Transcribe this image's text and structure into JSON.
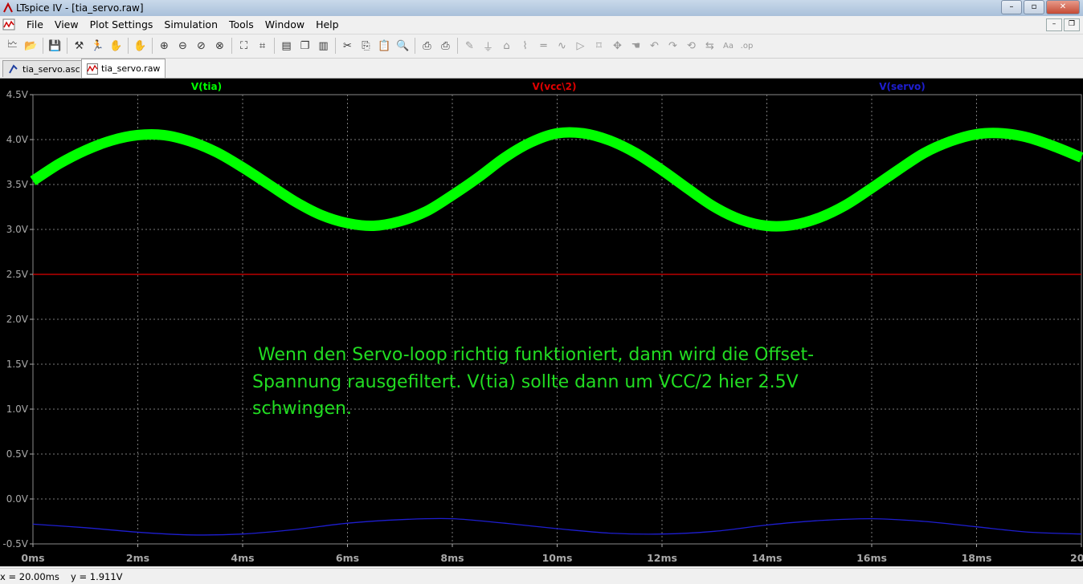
{
  "window": {
    "title": "LTspice IV - [tia_servo.raw]"
  },
  "window_buttons": [
    "–",
    "▫",
    "✕"
  ],
  "menu": [
    "File",
    "View",
    "Plot Settings",
    "Simulation",
    "Tools",
    "Window",
    "Help"
  ],
  "mdi_buttons": [
    "–",
    "❐"
  ],
  "toolbar": {
    "icons": [
      "new-schematic-icon",
      "open-icon",
      "save-icon",
      "control-panel-icon",
      "run-icon",
      "halt-icon",
      "pan-icon",
      "zoom-in-icon",
      "zoom-out-icon",
      "zoom-fit-icon",
      "zoom-cancel-icon",
      "autorange-icon",
      "mark-icon",
      "tile-vertical-icon",
      "cascade-icon",
      "tile-horizontal-icon",
      "cut-icon",
      "copy-icon",
      "paste-icon",
      "find-icon",
      "print-preview-icon",
      "print-icon",
      "wire-icon",
      "ground-icon",
      "label-icon",
      "resistor-icon",
      "capacitor-icon",
      "inductor-icon",
      "diode-icon",
      "component-icon",
      "move-icon",
      "drag-icon",
      "undo-icon",
      "redo-icon",
      "rotate-icon",
      "mirror-icon",
      "text-icon",
      "spice-directive-icon"
    ]
  },
  "tabs": [
    {
      "label": "tia_servo.asc",
      "icon": "schematic-icon"
    },
    {
      "label": "tia_servo.raw",
      "icon": "waveform-icon",
      "active": true
    }
  ],
  "chart_data": {
    "type": "line",
    "background": "#000000",
    "grid": true,
    "xlim": [
      0,
      20
    ],
    "ylim": [
      -0.5,
      4.5
    ],
    "x_ticks": [
      "0ms",
      "2ms",
      "4ms",
      "6ms",
      "8ms",
      "10ms",
      "12ms",
      "14ms",
      "16ms",
      "18ms",
      "20ms"
    ],
    "y_ticks": [
      "4.5V",
      "4.0V",
      "3.5V",
      "3.0V",
      "2.5V",
      "2.0V",
      "1.5V",
      "1.0V",
      "0.5V",
      "0.0V",
      "-0.5V"
    ],
    "series": [
      {
        "name": "V(tia)",
        "color": "#00ff00",
        "x": [
          0,
          0.5,
          1,
          1.5,
          2,
          2.5,
          3,
          3.5,
          4,
          4.5,
          5,
          5.5,
          6,
          6.5,
          7,
          7.5,
          8,
          8.5,
          9,
          9.5,
          10,
          10.5,
          11,
          11.5,
          12,
          12.5,
          13,
          13.5,
          14,
          14.5,
          15,
          15.5,
          16,
          16.5,
          17,
          17.5,
          18,
          18.5,
          19,
          19.5,
          20
        ],
        "values": [
          3.54,
          3.73,
          3.88,
          3.99,
          4.05,
          4.05,
          3.98,
          3.86,
          3.69,
          3.5,
          3.31,
          3.16,
          3.07,
          3.04,
          3.09,
          3.2,
          3.38,
          3.58,
          3.8,
          3.97,
          4.07,
          4.07,
          3.99,
          3.85,
          3.66,
          3.45,
          3.25,
          3.11,
          3.04,
          3.05,
          3.13,
          3.27,
          3.46,
          3.66,
          3.85,
          3.98,
          4.06,
          4.07,
          4.02,
          3.92,
          3.8
        ]
      },
      {
        "name": "V(vcc\\2)",
        "color": "#e00000",
        "x": [
          0,
          20
        ],
        "values": [
          2.5,
          2.5
        ]
      },
      {
        "name": "V(servo)",
        "color": "#1e1ed0",
        "x": [
          0,
          1,
          2,
          3,
          4,
          5,
          6,
          7,
          8,
          9,
          10,
          11,
          12,
          13,
          14,
          15,
          16,
          17,
          18,
          19,
          20
        ],
        "values": [
          -0.28,
          -0.32,
          -0.37,
          -0.4,
          -0.39,
          -0.34,
          -0.27,
          -0.23,
          -0.22,
          -0.27,
          -0.33,
          -0.38,
          -0.39,
          -0.36,
          -0.29,
          -0.24,
          -0.22,
          -0.25,
          -0.31,
          -0.37,
          -0.39
        ]
      }
    ],
    "annotation": [
      " Wenn den Servo-loop richtig funktioniert, dann wird die Offset-",
      "Spannung rausgefiltert. V(tia) sollte dann um VCC/2 hier 2.5V",
      "schwingen."
    ],
    "annotation_color": "#22dd22"
  },
  "status": {
    "x": "x = 20.00ms",
    "y": "y = 1.911V"
  }
}
